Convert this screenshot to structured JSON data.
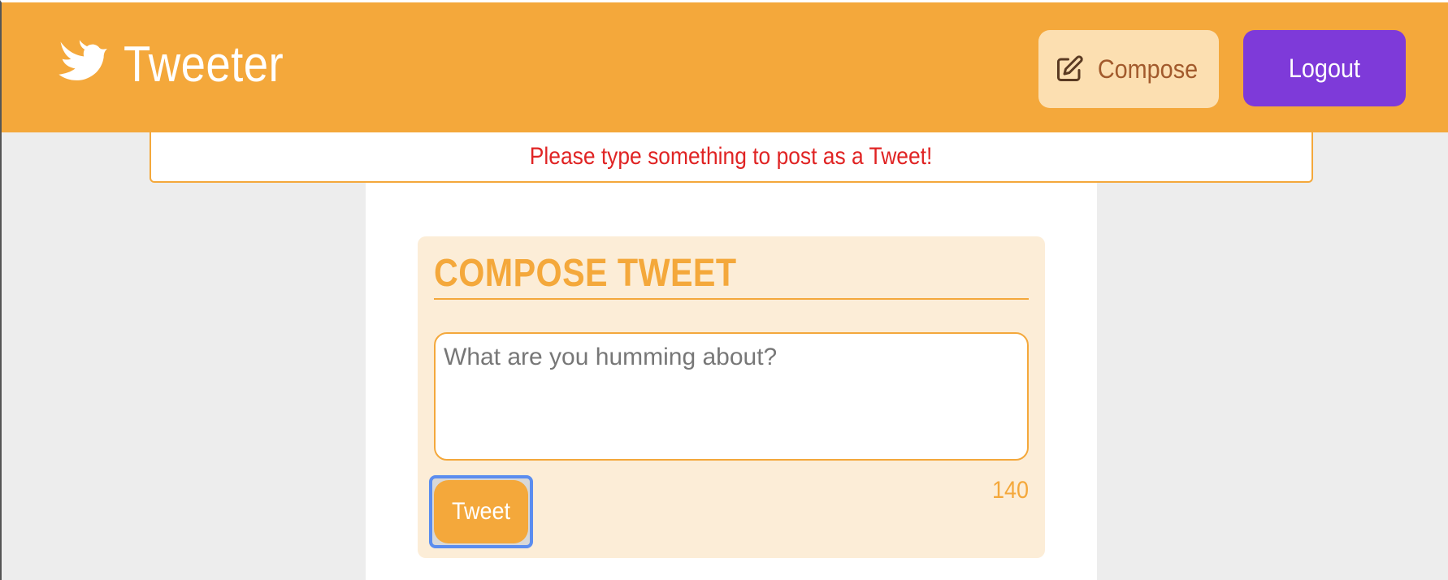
{
  "app": {
    "title": "Tweeter",
    "brand_icon": "bird-icon",
    "colors": {
      "header": "#f4a83b",
      "compose_button_bg": "#fcdfb1",
      "logout_button_bg": "#7e3ad9",
      "error_text": "#e02424",
      "accent": "#f4a83b",
      "card_bg": "#fcedd7"
    }
  },
  "header": {
    "compose_label": "Compose",
    "compose_icon": "pencil-square-icon",
    "logout_label": "Logout"
  },
  "error": {
    "message": "Please type something to post as a Tweet!"
  },
  "compose": {
    "title": "COMPOSE TWEET",
    "placeholder": "What are you humming about?",
    "value": "",
    "submit_label": "Tweet",
    "char_count": "140"
  }
}
